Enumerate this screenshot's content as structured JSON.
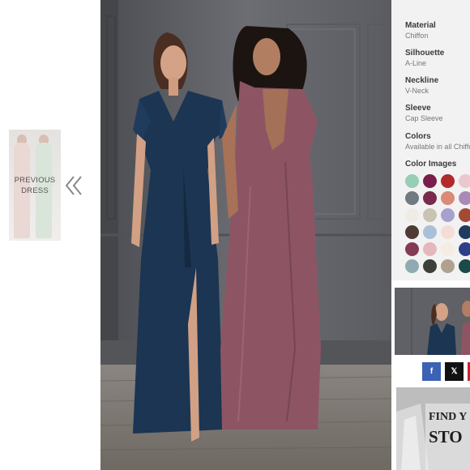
{
  "prev_dress": {
    "label_line1": "PREVIOUS",
    "label_line2": "DRESS",
    "icon": "double-chevron-left-icon"
  },
  "specs": {
    "material": {
      "label": "Material",
      "value": "Chiffon"
    },
    "silhouette": {
      "label": "Silhouette",
      "value": "A-Line"
    },
    "neckline": {
      "label": "Neckline",
      "value": "V-Neck"
    },
    "sleeve": {
      "label": "Sleeve",
      "value": "Cap Sleeve"
    },
    "colors": {
      "label": "Colors",
      "value": "Available in all Chiffon"
    },
    "color_images": {
      "label": "Color Images"
    }
  },
  "swatch_colors": [
    [
      "#98cdb6",
      "#7a1d4a",
      "#b22a2a",
      "#e9c9cf"
    ],
    [
      "#707a80",
      "#7a2a4a",
      "#d98a78",
      "#a88ab8"
    ],
    [
      "#f0ebe4",
      "#c8c3b2",
      "#a7a1cf",
      "#a44a34"
    ],
    [
      "#4e3c34",
      "#a9c0d7",
      "#f4ddd6",
      "#1f3c60"
    ],
    [
      "#843b54",
      "#e5b7bd",
      "#f5ece2",
      "#2b3f8a"
    ],
    [
      "#8faab1",
      "#3c4038",
      "#b0a08f",
      "#1a4a4a"
    ]
  ],
  "share": {
    "facebook": {
      "icon": "facebook-icon",
      "glyph": "f",
      "color": "#3b62b5"
    },
    "x": {
      "icon": "x-icon",
      "glyph": "𝕏",
      "color": "#111111"
    }
  },
  "banner": {
    "line1": "FIND Y",
    "line2": "STO"
  }
}
